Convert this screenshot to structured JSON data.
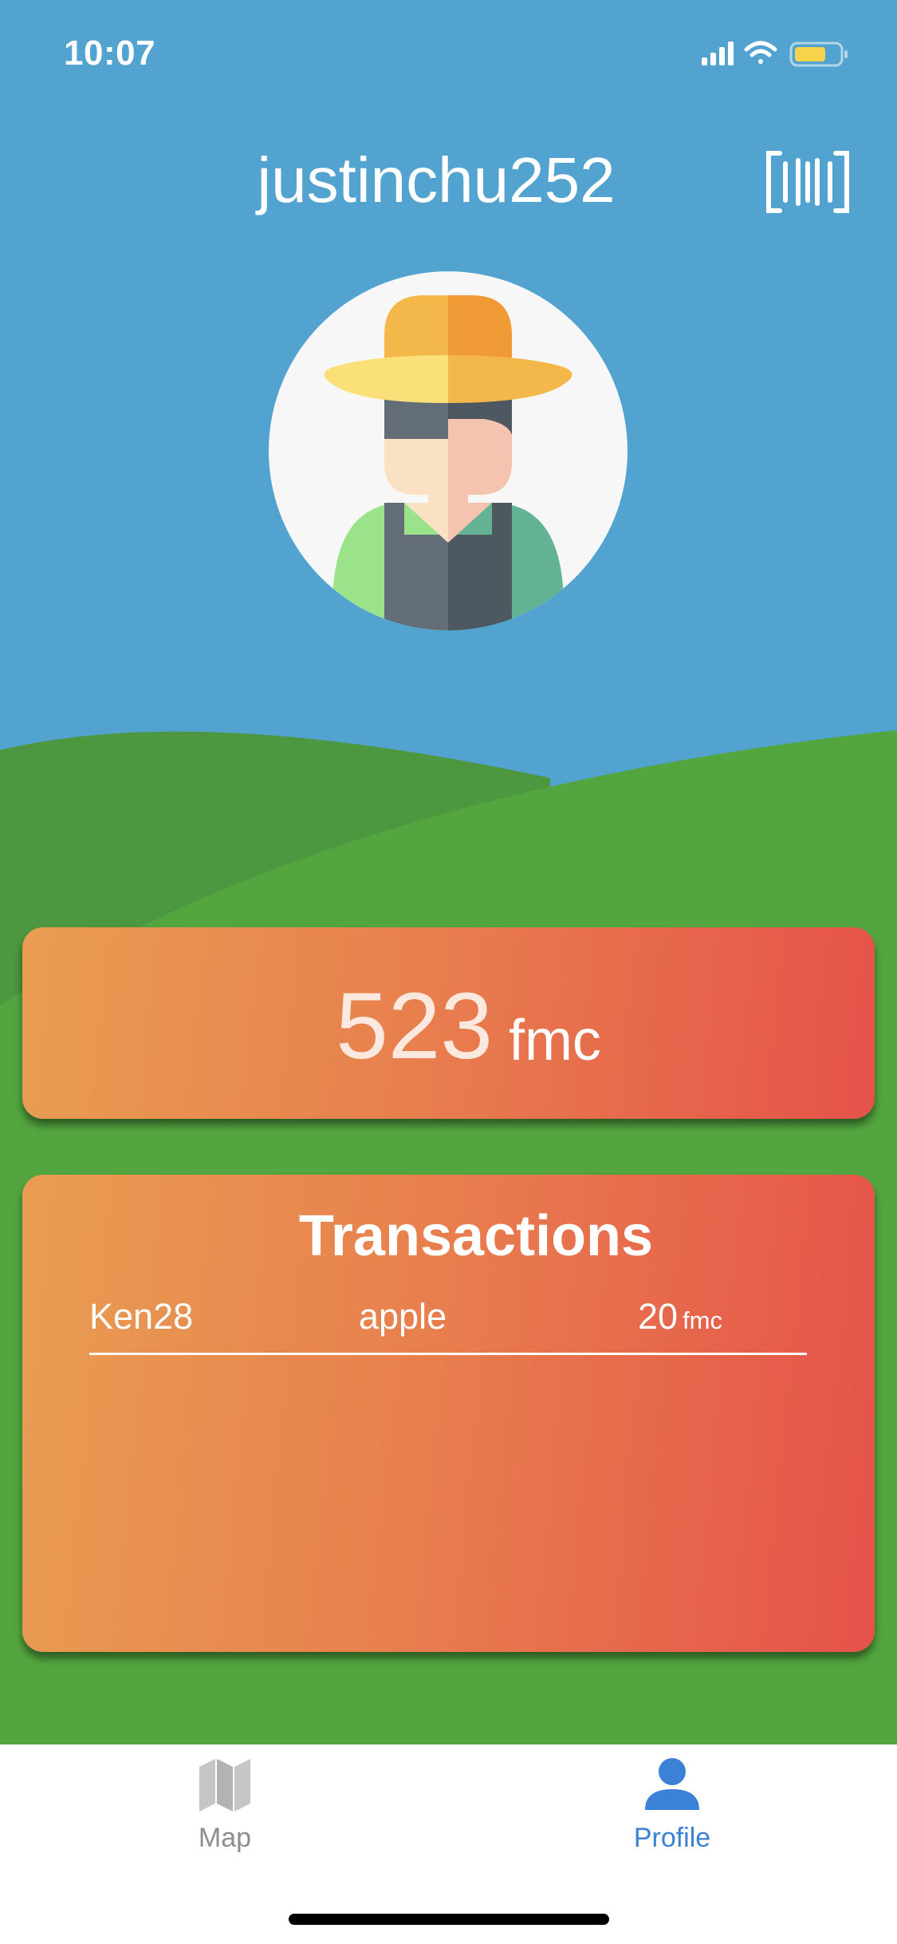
{
  "status_bar": {
    "time": "10:07",
    "icons": [
      "signal-icon",
      "wifi-icon",
      "battery-icon"
    ]
  },
  "header": {
    "username": "justinchu252",
    "barcode_icon": "barcode-icon"
  },
  "avatar": {
    "icon": "farmer-avatar"
  },
  "balance": {
    "value": "523",
    "unit": "fmc"
  },
  "transactions": {
    "title": "Transactions",
    "rows": [
      {
        "user": "Ken28",
        "item": "apple",
        "amount": "20",
        "unit": "fmc"
      }
    ]
  },
  "tab_bar": {
    "tabs": [
      {
        "label": "Map",
        "icon": "map-icon",
        "active": false
      },
      {
        "label": "Profile",
        "icon": "person-icon",
        "active": true
      }
    ]
  },
  "colors": {
    "sky": "#52a3cf",
    "hill_back": "#4c973f",
    "hill_front": "#53a63f",
    "card_start": "#e99d52",
    "card_end": "#e5524a",
    "active_tab": "#3b82d6",
    "inactive_tab": "#8e8e8e"
  }
}
